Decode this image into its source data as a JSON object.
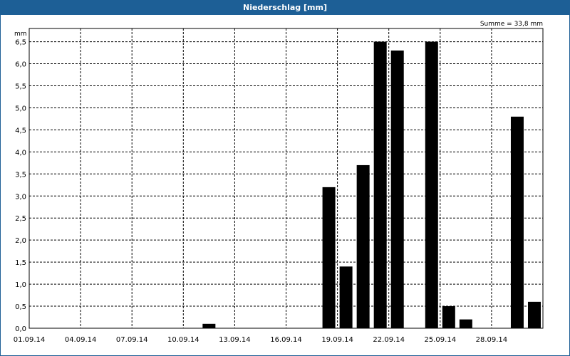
{
  "title": "Niederschlag [mm]",
  "summary": "Summe = 33,8 mm",
  "colors": {
    "titlebar": "#1d5f96",
    "bar": "#000000",
    "grid": "#000000"
  },
  "chart_data": {
    "type": "bar",
    "title": "Niederschlag [mm]",
    "ylabel": "mm",
    "ylim": [
      0,
      6.8
    ],
    "yticks": [
      "0,0",
      "0,5",
      "1,0",
      "1,5",
      "2,0",
      "2,5",
      "3,0",
      "3,5",
      "4,0",
      "4,5",
      "5,0",
      "5,5",
      "6,0",
      "6,5"
    ],
    "xticks": [
      "01.09.14",
      "04.09.14",
      "07.09.14",
      "10.09.14",
      "13.09.14",
      "16.09.14",
      "19.09.14",
      "22.09.14",
      "25.09.14",
      "28.09.14"
    ],
    "grid": true,
    "categories": [
      "01.09.14",
      "02.09.14",
      "03.09.14",
      "04.09.14",
      "05.09.14",
      "06.09.14",
      "07.09.14",
      "08.09.14",
      "09.09.14",
      "10.09.14",
      "11.09.14",
      "12.09.14",
      "13.09.14",
      "14.09.14",
      "15.09.14",
      "16.09.14",
      "17.09.14",
      "18.09.14",
      "19.09.14",
      "20.09.14",
      "21.09.14",
      "22.09.14",
      "23.09.14",
      "24.09.14",
      "25.09.14",
      "26.09.14",
      "27.09.14",
      "28.09.14",
      "29.09.14",
      "30.09.14"
    ],
    "values": [
      0,
      0,
      0,
      0,
      0,
      0,
      0,
      0,
      0,
      0,
      0.1,
      0,
      0,
      0,
      0,
      0,
      0,
      3.2,
      1.4,
      3.7,
      6.5,
      6.3,
      0,
      6.5,
      0.5,
      0.2,
      0,
      0,
      4.8,
      0.6
    ]
  }
}
